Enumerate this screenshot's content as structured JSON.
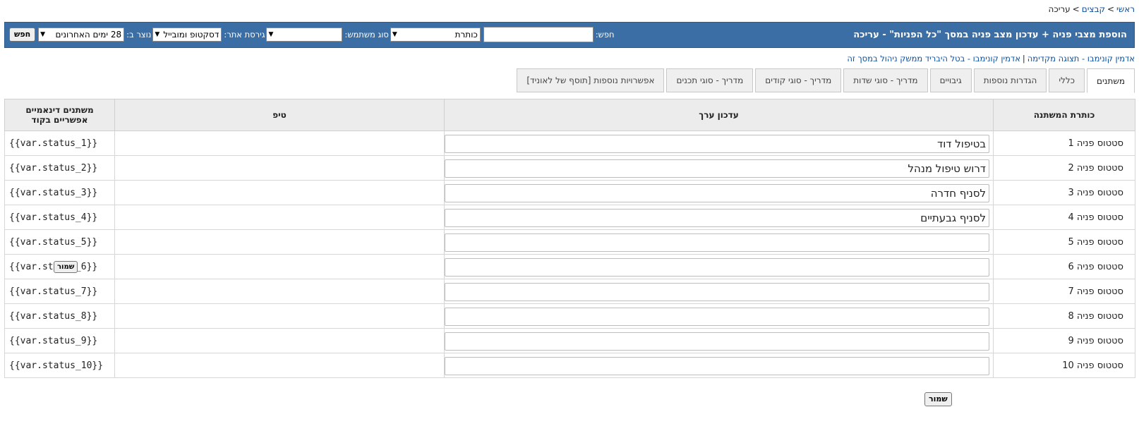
{
  "breadcrumb": {
    "home": "ראשי",
    "files": "קבצים",
    "current": "עריכה",
    "separator": ">"
  },
  "header": {
    "title": "הוספת מצבי פניה + עדכון מצב פניה במסך \"כל הפניות\" - עריכה",
    "search": {
      "search_label": "חפש:",
      "field_select": "כותרת",
      "user_type_label": "סוג משתמש:",
      "user_type_value": "",
      "site_version_label": "גירסת אתר:",
      "site_version_value": "דסקטופ ומובייל",
      "created_label": "נוצר ב:",
      "created_value": "28 ימים האחרונים",
      "button": "חפש"
    }
  },
  "admin_links": {
    "preview": "אדמין קונימבו - תצוגה מקדימה",
    "divider": "|",
    "cancel_hybrid": "אדמין קונימבו - בטל היבריד ממשק ניהול במסך זה"
  },
  "tabs": [
    {
      "label": "משתנים",
      "active": true
    },
    {
      "label": "כללי"
    },
    {
      "label": "הגדרות נוספות"
    },
    {
      "label": "גיבויים"
    },
    {
      "label": "מדריך - סוגי שדות"
    },
    {
      "label": "מדריך - סוגי קודים"
    },
    {
      "label": "מדריך - סוגי תכנים"
    },
    {
      "label": "אפשרויות נוספות [תוסף של לאוניד]"
    }
  ],
  "table": {
    "headers": {
      "variable_title": "כותרת המשתנה",
      "value_editor": "עדכון ערך",
      "tip": "טיפ",
      "dynamic_vars_line1": "משתנים דינאמיים",
      "dynamic_vars_line2": "אפשריים בקוד"
    },
    "rows": [
      {
        "label": "סטטוס פניה 1",
        "value": "בטיפול דוד",
        "var": "{{var.status_1}}"
      },
      {
        "label": "סטטוס פניה 2",
        "value": "דרוש טיפול מנהל",
        "var": "{{var.status_2}}"
      },
      {
        "label": "סטטוס פניה 3",
        "value": "לסניף חדרה",
        "var": "{{var.status_3}}"
      },
      {
        "label": "סטטוס פניה 4",
        "value": "לסניף גבעתיים",
        "var": "{{var.status_4}}"
      },
      {
        "label": "סטטוס פניה 5",
        "value": "",
        "var": "{{var.status_5}}"
      },
      {
        "label": "סטטוס פניה 6",
        "value": "",
        "var": "{{var.status_6}}"
      },
      {
        "label": "סטטוס פניה 7",
        "value": "",
        "var": "{{var.status_7}}"
      },
      {
        "label": "סטטוס פניה 8",
        "value": "",
        "var": "{{var.status_8}}"
      },
      {
        "label": "סטטוס פניה 9",
        "value": "",
        "var": "{{var.status_9}}"
      },
      {
        "label": "סטטוס פניה 10",
        "value": "",
        "var": "{{var.status_10}}"
      }
    ],
    "floating_save": "שמור"
  },
  "save_button": "שמור"
}
